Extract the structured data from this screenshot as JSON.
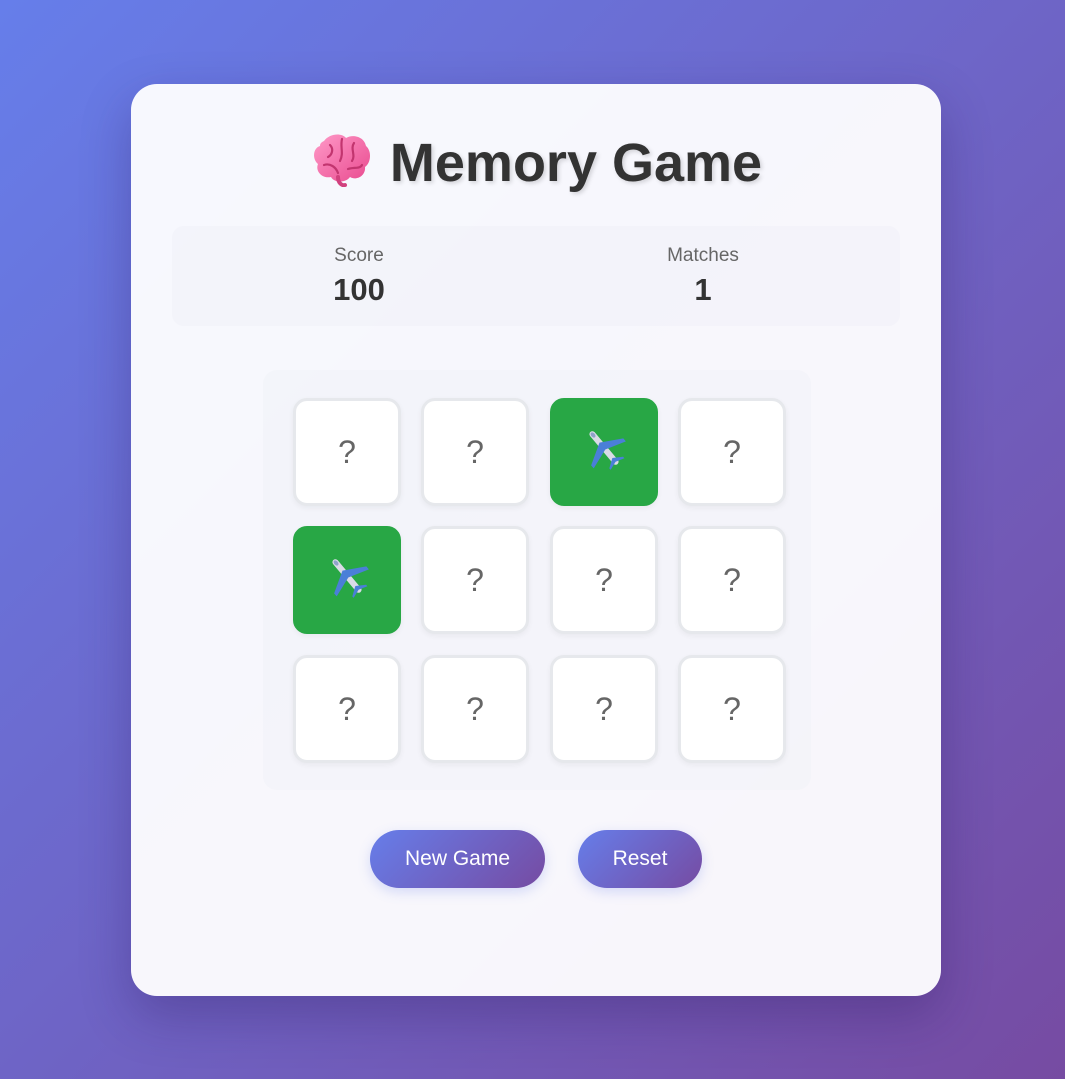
{
  "game": {
    "title": "Memory Game",
    "title_icon": "brain-icon",
    "score_label": "Score",
    "score_value": "100",
    "matches_label": "Matches",
    "matches_value": "1"
  },
  "board": {
    "rows": 3,
    "cols": 4,
    "hidden_symbol": "?",
    "tiles": [
      {
        "state": "hidden",
        "symbol": "?"
      },
      {
        "state": "hidden",
        "symbol": "?"
      },
      {
        "state": "matched",
        "icon": "airplane-icon"
      },
      {
        "state": "hidden",
        "symbol": "?"
      },
      {
        "state": "matched",
        "icon": "airplane-icon"
      },
      {
        "state": "hidden",
        "symbol": "?"
      },
      {
        "state": "hidden",
        "symbol": "?"
      },
      {
        "state": "hidden",
        "symbol": "?"
      },
      {
        "state": "hidden",
        "symbol": "?"
      },
      {
        "state": "hidden",
        "symbol": "?"
      },
      {
        "state": "hidden",
        "symbol": "?"
      },
      {
        "state": "hidden",
        "symbol": "?"
      }
    ]
  },
  "buttons": {
    "new_game_label": "New Game",
    "reset_label": "Reset"
  },
  "colors": {
    "background_start": "#667eea",
    "background_end": "#764ba2",
    "matched": "#28a745",
    "title_text": "#333333",
    "label_text": "#666666"
  }
}
